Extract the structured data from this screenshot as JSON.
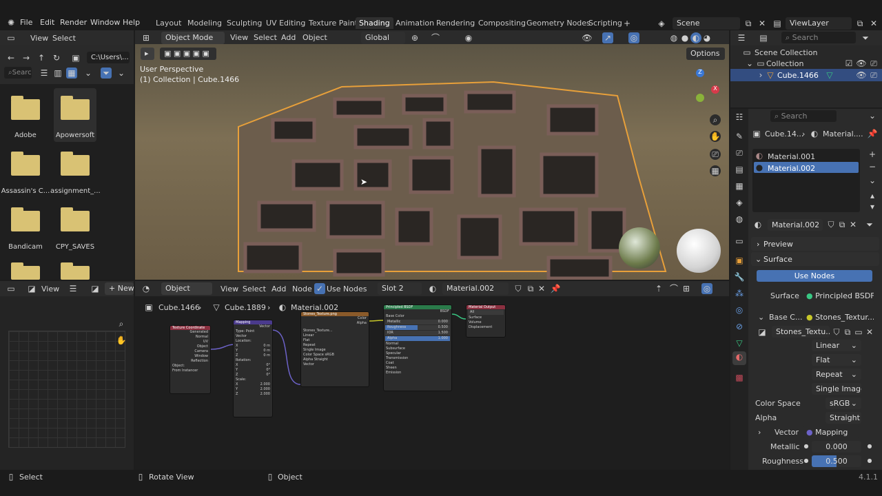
{
  "menus": [
    "File",
    "Edit",
    "Render",
    "Window",
    "Help"
  ],
  "workspaces": [
    "Layout",
    "Modeling",
    "Sculpting",
    "UV Editing",
    "Texture Paint",
    "Shading",
    "Animation",
    "Rendering",
    "Compositing",
    "Geometry Nodes",
    "Scripting"
  ],
  "active_workspace": "Shading",
  "scene": "Scene",
  "view_layer": "ViewLayer",
  "filebrowser": {
    "view": "View",
    "select": "Select",
    "path": "C:\\Users\\...",
    "search_placeholder": "Search",
    "folders": [
      "Adobe",
      "Apowersoft",
      "Assassin's C...",
      "assignment_...",
      "Bandicam",
      "CPY_SAVES",
      "",
      ""
    ]
  },
  "viewport": {
    "mode": "Object Mode",
    "view": "View",
    "select": "Select",
    "add": "Add",
    "object": "Object",
    "orientation": "Global",
    "options": "Options",
    "line1": "User Perspective",
    "line2": "(1) Collection | Cube.1466"
  },
  "outliner": {
    "search": "Search",
    "scene_collection": "Scene Collection",
    "collection": "Collection",
    "object": "Cube.1466"
  },
  "properties": {
    "search": "Search",
    "crumb_obj": "Cube.14...",
    "crumb_mat": "Material....",
    "slots": [
      "Material.001",
      "Material.002"
    ],
    "material": "Material.002",
    "preview": "Preview",
    "surface_panel": "Surface",
    "use_nodes": "Use Nodes",
    "surface_label": "Surface",
    "surface_value": "Principled BSDF",
    "base_color_label": "Base C...",
    "base_color_value": "Stones_Textur...",
    "image_name": "Stones_Textu...",
    "interp": "Linear",
    "projection": "Flat",
    "extension": "Repeat",
    "source": "Single Image",
    "color_space_label": "Color Space",
    "color_space": "sRGB",
    "alpha_label": "Alpha",
    "alpha": "Straight",
    "vector_label": "Vector",
    "vector": "Mapping",
    "metallic_label": "Metallic",
    "metallic": "0.000",
    "roughness_label": "Roughness",
    "roughness": "0.500",
    "roughness_fraction": 0.5
  },
  "node_editor": {
    "object": "Object",
    "view": "View",
    "select": "Select",
    "add": "Add",
    "node": "Node",
    "use_nodes": "Use Nodes",
    "slot": "Slot 2",
    "material": "Material.002",
    "crumb1": "Cube.1466",
    "crumb2": "Cube.1889",
    "crumb3": "Material.002"
  },
  "left_editor": {
    "view": "View",
    "new": "New"
  },
  "nodes": {
    "texcoord": {
      "title": "Texture Coordinate",
      "rows": [
        "Generated",
        "Normal",
        "UV",
        "Object",
        "Camera",
        "Window",
        "Reflection",
        "Object:",
        "From Instancer"
      ]
    },
    "mapping": {
      "title": "Mapping",
      "rows": [
        "Vector",
        "Type:",
        "Point",
        "Vector",
        "Location:",
        "X",
        "0 m",
        "Y",
        "0 m",
        "Z",
        "0 m",
        "Rotation:",
        "X",
        "0°",
        "Y",
        "0°",
        "Z",
        "0°",
        "Scale:",
        "X",
        "2.000",
        "Y",
        "2.000",
        "Z",
        "2.000"
      ]
    },
    "image": {
      "title": "Stones_Texture.png",
      "rows": [
        "Color",
        "Alpha",
        "Stones_Texture...",
        "Linear",
        "Flat",
        "Repeat",
        "Single Image",
        "Color Space",
        "sRGB",
        "Alpha",
        "Straight",
        "Vector"
      ]
    },
    "bsdf": {
      "title": "Principled BSDF",
      "rows": [
        "BSDF",
        "Base Color",
        "Metallic",
        "0.000",
        "Roughness",
        "0.500",
        "IOR",
        "1.500",
        "Alpha",
        "1.000",
        "Normal",
        "Subsurface",
        "Specular",
        "Transmission",
        "Coat",
        "Sheen",
        "Emission"
      ]
    },
    "output": {
      "title": "Material Output",
      "rows": [
        "All",
        "Surface",
        "Volume",
        "Displacement"
      ]
    }
  },
  "status": {
    "select": "Select",
    "rotate": "Rotate View",
    "object": "Object",
    "version": "4.1.1"
  }
}
